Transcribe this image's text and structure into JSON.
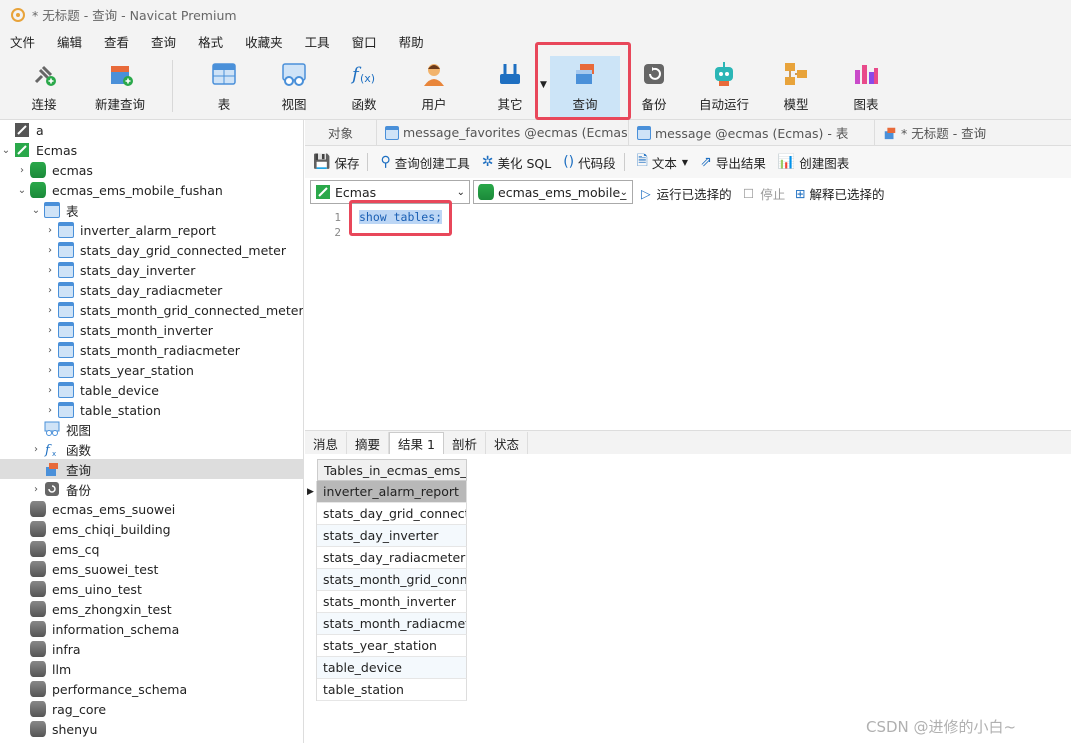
{
  "window": {
    "title": "* 无标题 - 查询 - Navicat Premium"
  },
  "menu": [
    "文件",
    "编辑",
    "查看",
    "查询",
    "格式",
    "收藏夹",
    "工具",
    "窗口",
    "帮助"
  ],
  "toolbar": {
    "connect": "连接",
    "new_query": "新建查询",
    "table": "表",
    "view": "视图",
    "function": "函数",
    "user": "用户",
    "other": "其它",
    "query": "查询",
    "backup": "备份",
    "automation": "自动运行",
    "model": "模型",
    "chart": "图表"
  },
  "sidebar": {
    "conn_a": "a",
    "conn_ecmas": "Ecmas",
    "db_ecmas": "ecmas",
    "db_fushan": "ecmas_ems_mobile_fushan",
    "tables_label": "表",
    "tables": [
      "inverter_alarm_report",
      "stats_day_grid_connected_meter",
      "stats_day_inverter",
      "stats_day_radiacmeter",
      "stats_month_grid_connected_meter",
      "stats_month_inverter",
      "stats_month_radiacmeter",
      "stats_year_station",
      "table_device",
      "table_station"
    ],
    "views_label": "视图",
    "functions_label": "函数",
    "queries_label": "查询",
    "backups_label": "备份",
    "other_dbs": [
      "ecmas_ems_suowei",
      "ems_chiqi_building",
      "ems_cq",
      "ems_suowei_test",
      "ems_uino_test",
      "ems_zhongxin_test",
      "information_schema",
      "infra",
      "llm",
      "performance_schema",
      "rag_core",
      "shenyu"
    ]
  },
  "tabs": {
    "objects": "对象",
    "t1": "message_favorites @ecmas (Ecmas) ...",
    "t2": "message @ecmas (Ecmas) - 表",
    "t3": "* 无标题 - 查询"
  },
  "qtoolbar": {
    "save": "保存",
    "builder": "查询创建工具",
    "beautify": "美化 SQL",
    "snippet": "代码段",
    "text": "文本",
    "export": "导出结果",
    "create_chart": "创建图表",
    "run_selected": "运行已选择的",
    "stop": "停止",
    "explain": "解释已选择的"
  },
  "selectors": {
    "connection": "Ecmas",
    "database": "ecmas_ems_mobile_"
  },
  "editor": {
    "line1": "1",
    "line2": "2",
    "code": "show tables;"
  },
  "result_tabs": {
    "message": "消息",
    "summary": "摘要",
    "result1": "结果 1",
    "profile": "剖析",
    "status": "状态"
  },
  "result": {
    "header": "Tables_in_ecmas_ems_m",
    "rows": [
      "inverter_alarm_report",
      "stats_day_grid_connecte",
      "stats_day_inverter",
      "stats_day_radiacmeter",
      "stats_month_grid_conne",
      "stats_month_inverter",
      "stats_month_radiacmete",
      "stats_year_station",
      "table_device",
      "table_station"
    ]
  },
  "watermark": "CSDN @进修的小白~"
}
